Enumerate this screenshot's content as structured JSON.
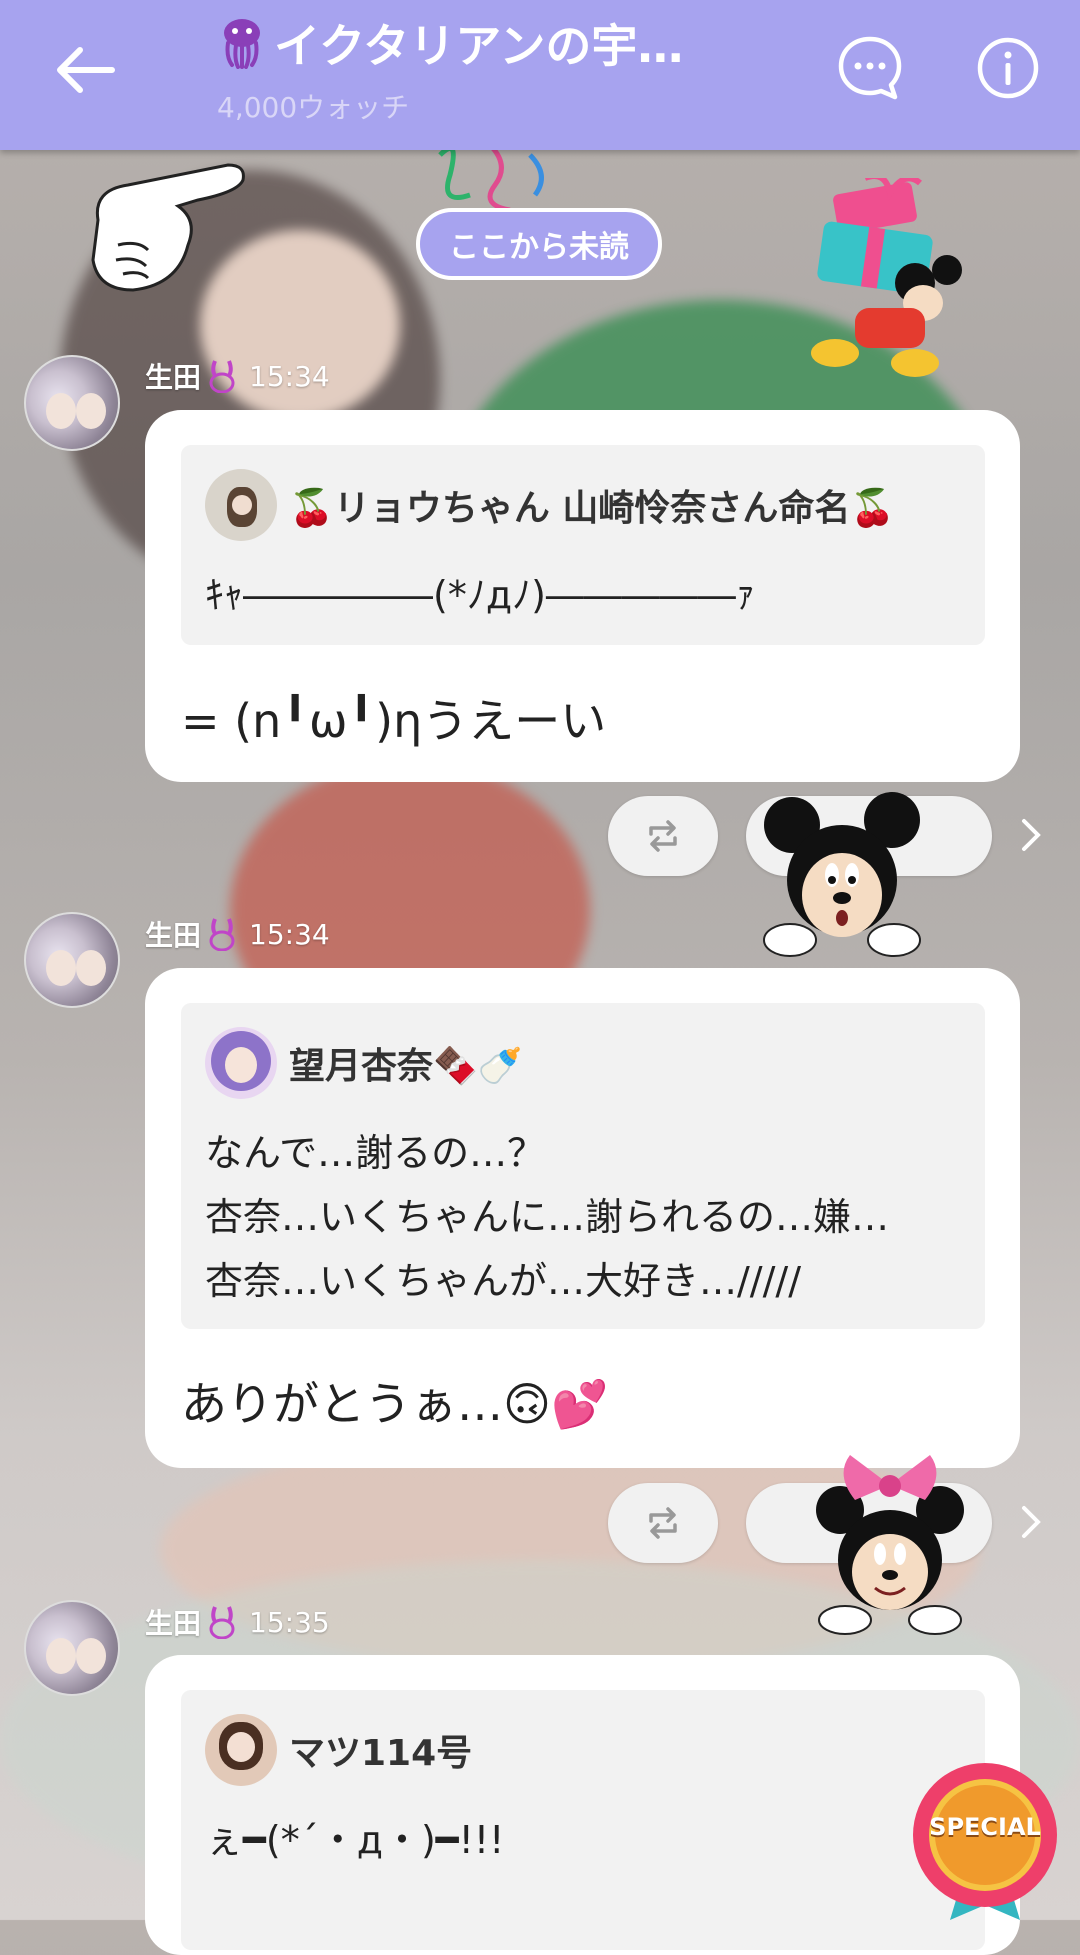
{
  "header": {
    "back_icon": "arrow-left-icon",
    "title": "イクタリアンの宇…",
    "subtitle": "4,000ウォッチ",
    "chat_icon": "chat-bubble-icon",
    "info_icon": "info-icon"
  },
  "unread_marker": "ここから未読",
  "messages": [
    {
      "sender": "生田",
      "time": "15:34",
      "quote_name": "🍒リョウちゃん 山崎怜奈さん命名🍒",
      "quote_text": "ｷｬ―――――(*ﾉдﾉ)―――――ｧ",
      "text": "= (n╹ω╹)ηうえーい"
    },
    {
      "sender": "生田",
      "time": "15:34",
      "quote_name": "望月杏奈🍫🍼",
      "quote_text": "なんで…謝るの…？\n杏奈…いくちゃんに…謝られるの…嫌…\n杏奈…いくちゃんが…大好き…/////",
      "text": "ありがとうぁ…🙃💕"
    },
    {
      "sender": "生田",
      "time": "15:35",
      "quote_name": "マツ114号",
      "quote_text": "ぇ━(*´・д・)━!!!",
      "text": ""
    }
  ],
  "stickers": [
    "pointing-glove-sticker",
    "party-popper-sticker",
    "mickey-gift-sticker",
    "mickey-peek-sticker",
    "minnie-peek-sticker",
    "special-badge-sticker"
  ],
  "special_badge": "SPECIAL",
  "colors": {
    "header": "#a7a3ef",
    "bubble": "#ffffff",
    "quote": "#f2f2f2"
  }
}
